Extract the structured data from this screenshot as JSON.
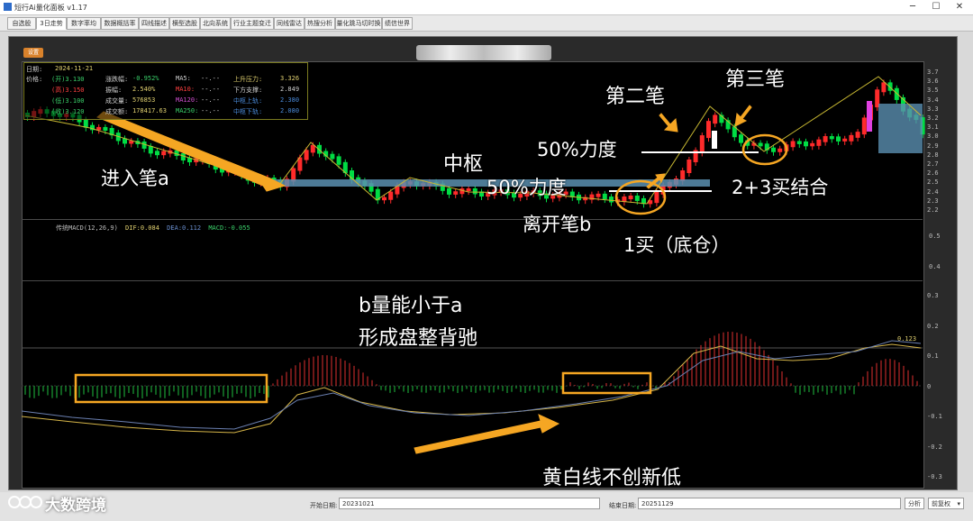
{
  "window": {
    "title": "短行Ai量化面板 v1.17"
  },
  "tabs": [
    "自选股",
    "3日走势",
    "数字率均",
    "数据概括率",
    "四线描述",
    "横型选股",
    "北向系统",
    "行业主题变迁",
    "同线雷达",
    "热搜分析",
    "量化跳马切时换",
    "绩信世界"
  ],
  "setting_button": "设置",
  "info": {
    "date_label": "日期:",
    "date": "2024-11-21",
    "price_label": "价格:",
    "open_lbl": "(开)3.130",
    "high_lbl": "(高)3.150",
    "low_lbl": "(低)3.100",
    "close_lbl": "(收)3.120",
    "chg_label": "涨跌幅:",
    "chg": "-0.952%",
    "amp_label": "振幅:",
    "amp": "2.540%",
    "vol_label": "成交量:",
    "vol": "576853",
    "amt_label": "成交额:",
    "amt": "178417.63",
    "ma5": "MA5:",
    "ma5v": "--.--",
    "ma10": "MA10:",
    "ma10v": "--.--",
    "ma120": "MA120:",
    "ma120v": "--.--",
    "ma250": "MA250:",
    "ma250v": "--.--",
    "up_label": "上升压力:",
    "up": "3.326",
    "down_label": "下方支撑:",
    "down": "2.849",
    "zs_up_label": "中枢上轨:",
    "zs_up": "2.380",
    "zs_dn_label": "中枢下轨:",
    "zs_dn": "2.080"
  },
  "price_axis": [
    "3.7",
    "3.6",
    "3.5",
    "3.4",
    "3.3",
    "3.2",
    "3.1",
    "3.0",
    "2.9",
    "2.8",
    "2.7",
    "2.6",
    "2.5",
    "2.4",
    "2.3",
    "2.2"
  ],
  "macd_upper_axis": [
    "0.5",
    "0.4"
  ],
  "macd_axis": [
    "0.3",
    "0.2",
    "0.1",
    "0",
    "-0.1",
    "-0.2",
    "-0.3"
  ],
  "macd_legend": {
    "name": "传统MACD(12,26,9)",
    "dif": "DIF:0.084",
    "dea": "DEA:0.112",
    "macd": "MACD:-0.055"
  },
  "macd_value_label": "0.123",
  "annotations": {
    "enter_a": "进入笔a",
    "zhongshu": "中枢",
    "force50_a": "50%力度",
    "force50_b": "50%力度",
    "leave_b": "离开笔b",
    "buy1": "1买（底仓）",
    "second": "第二笔",
    "third": "第三笔",
    "buy23": "2+3买结合",
    "b_vs_a": "b量能小于a",
    "divergence": "形成盘整背驰",
    "no_new_low": "黄白线不创新低"
  },
  "bottom": {
    "start_label": "开始日期:",
    "start_value": "20231021",
    "end_label": "结束日期:",
    "end_value": "20251129",
    "analyze": "分析",
    "adjust": "前复权"
  },
  "watermark": "大数跨境",
  "colors": {
    "up": "#ff2b2b",
    "down": "#00dd44",
    "annotation_orange": "#f5a623",
    "zhongshu_box": "#5a8fb0"
  }
}
